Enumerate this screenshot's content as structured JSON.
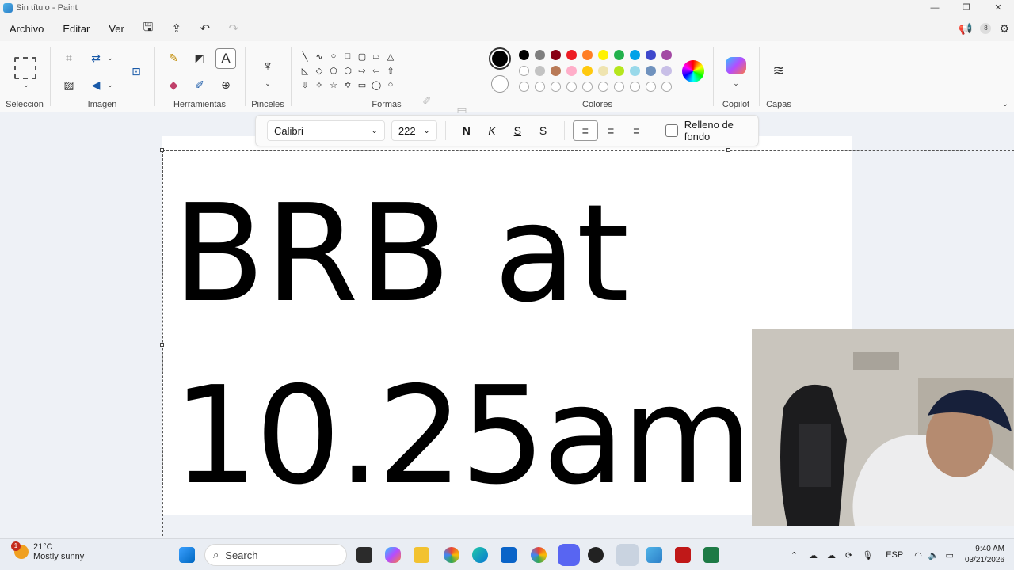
{
  "window": {
    "title": "Sin título - Paint",
    "minimize": "—",
    "maximize": "❐",
    "close": "✕"
  },
  "menu": {
    "archivo": "Archivo",
    "editar": "Editar",
    "ver": "Ver",
    "notification_count": "8"
  },
  "ribbon": {
    "groups": {
      "seleccion": "Selección",
      "imagen": "Imagen",
      "herramientas": "Herramientas",
      "pinceles": "Pinceles",
      "formas": "Formas",
      "colores": "Colores",
      "copilot": "Copilot",
      "capas": "Capas"
    },
    "palette_row1": [
      "#000000",
      "#7f7f7f",
      "#880015",
      "#ed1c24",
      "#ff7f27",
      "#fff200",
      "#22b14c",
      "#00a2e8",
      "#3f48cc",
      "#a349a4"
    ],
    "palette_row2": [
      "#ffffff",
      "#c3c3c3",
      "#b97a57",
      "#ffaec9",
      "#ffc90e",
      "#efe4b0",
      "#b5e61d",
      "#99d9ea",
      "#7092be",
      "#c8bfe7"
    ],
    "primary_color": "#000000",
    "secondary_color": "#ffffff"
  },
  "text_toolbar": {
    "font": "Calibri",
    "size": "222",
    "bold": "N",
    "italic": "K",
    "underline": "S",
    "strike": "S",
    "fill_label": "Relleno de fondo"
  },
  "canvas": {
    "line1": "BRB at",
    "line2": "10.25am"
  },
  "taskbar": {
    "weather_temp": "21°C",
    "weather_desc": "Mostly sunny",
    "weather_badge": "1",
    "search_label": "Search",
    "lang": "ESP",
    "time": "9:40 AM",
    "date": "03/21/2026"
  }
}
